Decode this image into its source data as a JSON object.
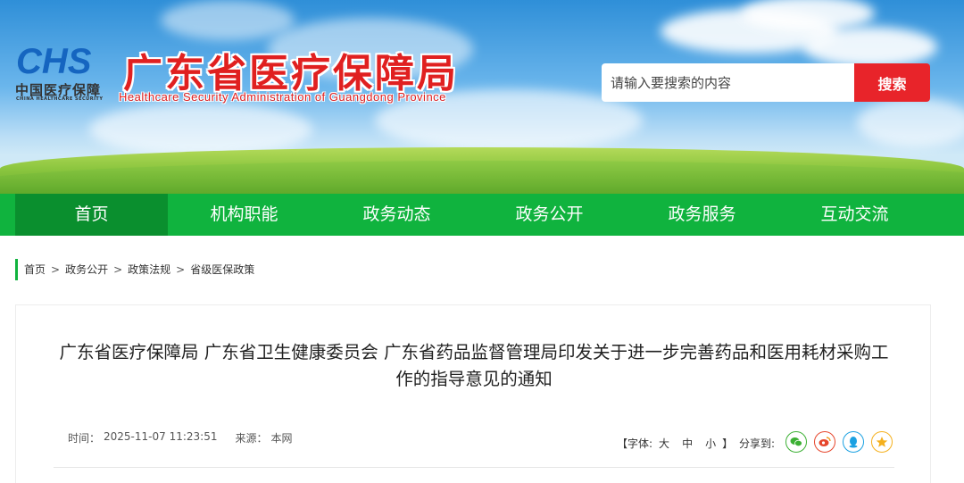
{
  "header": {
    "logo_text": "CHS",
    "logo_cn": "中国医疗保障",
    "logo_en": "CHINA HEALTHCARE SECURITY",
    "title": "广东省医疗保障局",
    "subtitle": "Healthcare Security Administration of Guangdong Province",
    "search": {
      "placeholder": "请输入要搜索的内容",
      "button_label": "搜索"
    }
  },
  "nav": {
    "items": [
      {
        "label": "首页",
        "active": true
      },
      {
        "label": "机构职能"
      },
      {
        "label": "政务动态"
      },
      {
        "label": "政务公开"
      },
      {
        "label": "政务服务"
      },
      {
        "label": "互动交流"
      }
    ]
  },
  "breadcrumb": [
    "首页",
    "政务公开",
    "政策法规",
    "省级医保政策"
  ],
  "breadcrumb_separator": ">",
  "article": {
    "title": "广东省医疗保障局 广东省卫生健康委员会 广东省药品监督管理局印发关于进一步完善药品和医用耗材采购工作的指导意见的通知",
    "time_label": "时间：",
    "time": "2025-11-07 11:23:51",
    "source_label": "来源：",
    "source": "本网",
    "font_label_open": "【字体:",
    "font_large": "大",
    "font_medium": "中",
    "font_small": "小",
    "font_label_close": "】",
    "share_label": "分享到:",
    "share_icons": [
      "wechat-icon",
      "weibo-icon",
      "qq-icon",
      "qzone-icon"
    ]
  },
  "colors": {
    "nav_green": "#10b33e",
    "nav_active": "#0a8f2e",
    "title_red": "#e02020",
    "search_red": "#e8242a"
  }
}
